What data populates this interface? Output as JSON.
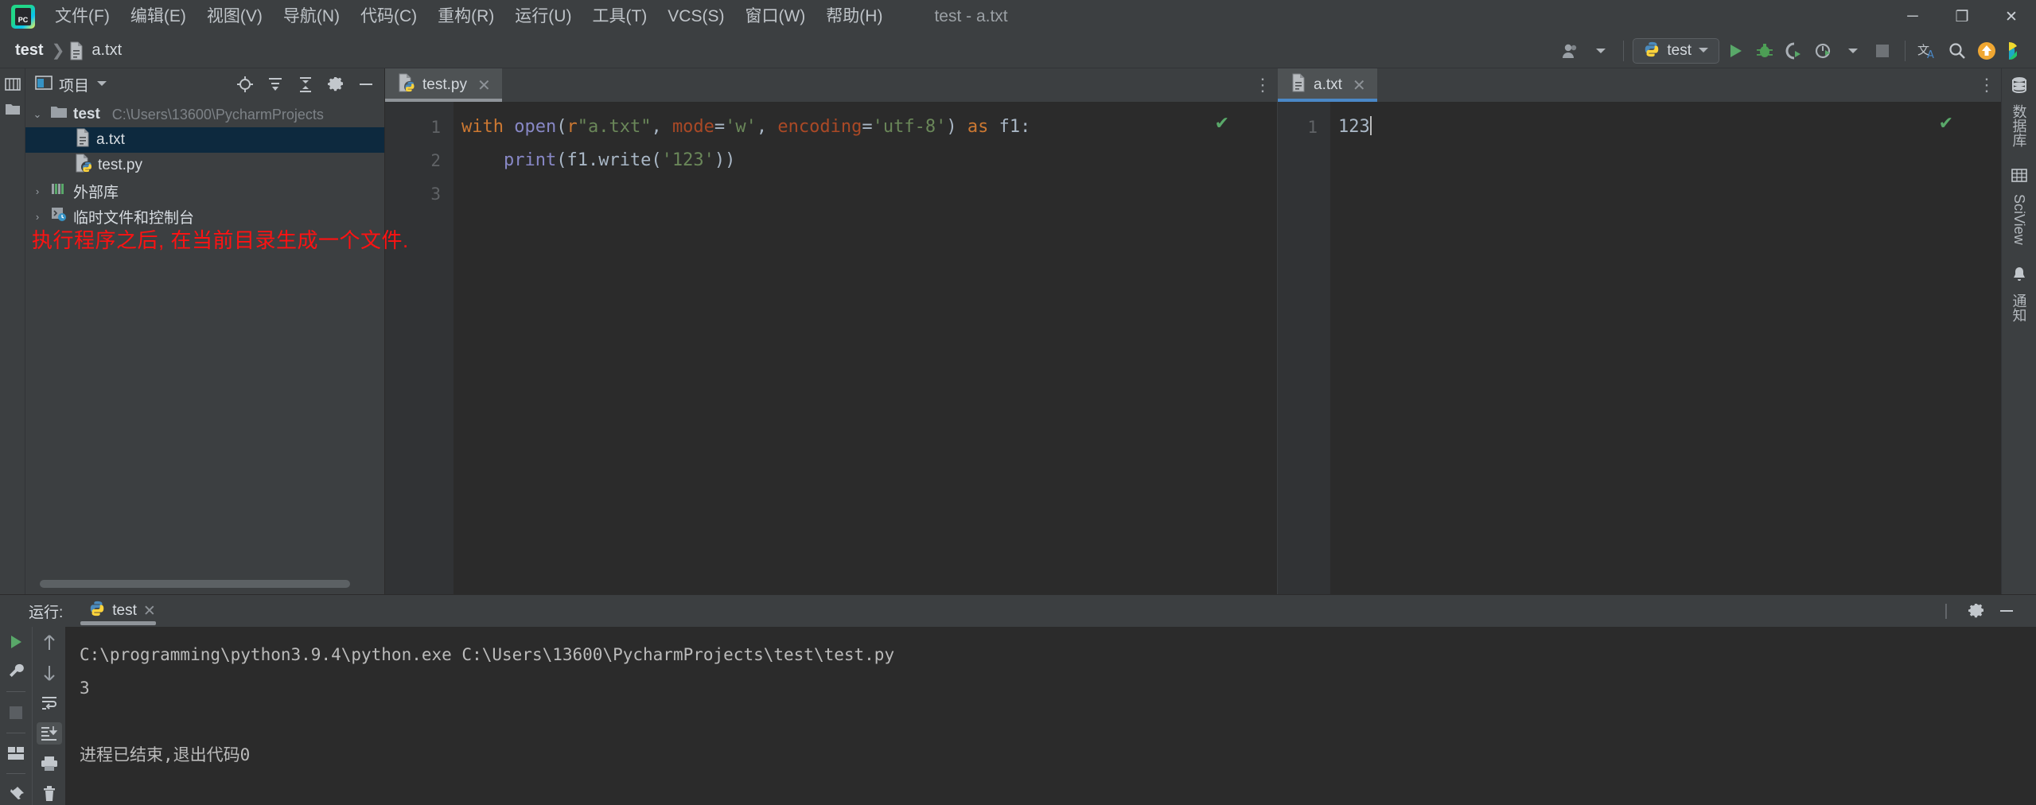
{
  "window": {
    "title": "test - a.txt",
    "logo_text": "PC",
    "controls": [
      {
        "name": "minimize",
        "glyph": "─"
      },
      {
        "name": "maximize",
        "glyph": "❐"
      },
      {
        "name": "close",
        "glyph": "✕"
      }
    ]
  },
  "menubar": {
    "items": [
      {
        "label": "文件(F)",
        "mnemonic": "F"
      },
      {
        "label": "编辑(E)",
        "mnemonic": "E"
      },
      {
        "label": "视图(V)",
        "mnemonic": "V"
      },
      {
        "label": "导航(N)",
        "mnemonic": "N"
      },
      {
        "label": "代码(C)",
        "mnemonic": "C"
      },
      {
        "label": "重构(R)",
        "mnemonic": "R"
      },
      {
        "label": "运行(U)",
        "mnemonic": "U"
      },
      {
        "label": "工具(T)",
        "mnemonic": "T"
      },
      {
        "label": "VCS(S)",
        "mnemonic": "S"
      },
      {
        "label": "窗口(W)",
        "mnemonic": "W"
      },
      {
        "label": "帮助(H)",
        "mnemonic": "H"
      }
    ]
  },
  "navbar": {
    "breadcrumbs": [
      {
        "label": "test",
        "icon": ""
      },
      {
        "label": "a.txt",
        "icon": "text-file-icon"
      }
    ],
    "separator": "❯",
    "run_config": "test",
    "icons": [
      "account-icon",
      "run-icon",
      "debug-icon",
      "coverage-icon",
      "profile-icon",
      "stop-icon",
      "translate-icon",
      "search-icon",
      "update-icon",
      "ide-feature-icon"
    ]
  },
  "left_strip": {
    "items": [
      {
        "name": "structure-tool-icon",
        "label": "结构"
      },
      {
        "name": "project-tool-icon",
        "label": "项目"
      }
    ]
  },
  "project_panel": {
    "title": "项目",
    "header_icons": [
      "locate-icon",
      "expand-all-icon",
      "collapse-all-icon",
      "gear-icon",
      "hide-icon"
    ],
    "tree": [
      {
        "level": 0,
        "arrow": "⌄",
        "name": "test",
        "bold": true,
        "path": "C:\\Users\\13600\\PycharmProjects",
        "icon": "folder-icon",
        "selected": false
      },
      {
        "level": 2,
        "arrow": "",
        "name": "a.txt",
        "bold": false,
        "path": "",
        "icon": "text-file-icon",
        "selected": true
      },
      {
        "level": 2,
        "arrow": "",
        "name": "test.py",
        "bold": false,
        "path": "",
        "icon": "python-file-icon",
        "selected": false
      },
      {
        "level": 0,
        "arrow": "›",
        "name": "外部库",
        "bold": false,
        "path": "",
        "icon": "library-icon",
        "selected": false
      },
      {
        "level": 0,
        "arrow": "›",
        "name": "临时文件和控制台",
        "bold": false,
        "path": "",
        "icon": "scratches-icon",
        "selected": false
      }
    ]
  },
  "annotation": {
    "text": "执行程序之后, 在当前目录生成一个文件.",
    "color": "#ff1212"
  },
  "editor_left": {
    "tab": {
      "label": "test.py",
      "icon": "python-file-icon",
      "close": "✕",
      "active": true
    },
    "line_numbers": [
      "1",
      "2",
      "3"
    ],
    "code_lines": [
      [
        {
          "t": "with ",
          "c": "kw"
        },
        {
          "t": "open",
          "c": "built"
        },
        {
          "t": "(",
          "c": "plain"
        },
        {
          "t": "r",
          "c": "pref"
        },
        {
          "t": "\"a.txt\"",
          "c": "str"
        },
        {
          "t": ", ",
          "c": "plain"
        },
        {
          "t": "mode",
          "c": "kwarg"
        },
        {
          "t": "=",
          "c": "plain"
        },
        {
          "t": "'w'",
          "c": "str"
        },
        {
          "t": ", ",
          "c": "plain"
        },
        {
          "t": "encoding",
          "c": "kwarg"
        },
        {
          "t": "=",
          "c": "plain"
        },
        {
          "t": "'utf-8'",
          "c": "str"
        },
        {
          "t": ") ",
          "c": "plain"
        },
        {
          "t": "as ",
          "c": "kw"
        },
        {
          "t": "f1:",
          "c": "plain"
        }
      ],
      [
        {
          "t": "    ",
          "c": "plain"
        },
        {
          "t": "print",
          "c": "built"
        },
        {
          "t": "(f1.write(",
          "c": "plain"
        },
        {
          "t": "'123'",
          "c": "str"
        },
        {
          "t": "))",
          "c": "plain"
        }
      ],
      []
    ],
    "inspection_ok": "✔",
    "more_icon": "⋮"
  },
  "editor_right": {
    "tab": {
      "label": "a.txt",
      "icon": "text-file-icon",
      "close": "✕",
      "active": true
    },
    "line_numbers": [
      "1"
    ],
    "content": "123",
    "inspection_ok": "✔",
    "more_icon": "⋮"
  },
  "right_strip": {
    "items": [
      {
        "label": "数据库",
        "icon": "database-icon"
      },
      {
        "label": "SciView",
        "icon": "sciview-icon"
      },
      {
        "label": "通知",
        "icon": "bell-icon"
      }
    ]
  },
  "run_panel": {
    "label": "运行:",
    "tab": {
      "label": "test",
      "icon": "python-file-icon",
      "close": "✕"
    },
    "header_icons": [
      "gear-icon",
      "hide-icon"
    ],
    "left_tools": [
      {
        "name": "rerun-icon",
        "active": false
      },
      {
        "name": "settings-wrench-icon",
        "active": false
      },
      {
        "name": "stop-icon",
        "active": false
      },
      {
        "name": "layout-icon",
        "active": false
      },
      {
        "name": "pin-icon",
        "active": false
      }
    ],
    "right_tools": [
      {
        "name": "up-arrow-icon",
        "active": false
      },
      {
        "name": "down-arrow-icon",
        "active": false
      },
      {
        "name": "soft-wrap-icon",
        "active": false
      },
      {
        "name": "scroll-to-end-icon",
        "active": true
      },
      {
        "name": "print-icon",
        "active": false
      },
      {
        "name": "trash-icon",
        "active": false
      }
    ],
    "console_lines": [
      "C:\\programming\\python3.9.4\\python.exe C:\\Users\\13600\\PycharmProjects\\test\\test.py",
      "3",
      "",
      "进程已结束,退出代码0"
    ]
  }
}
